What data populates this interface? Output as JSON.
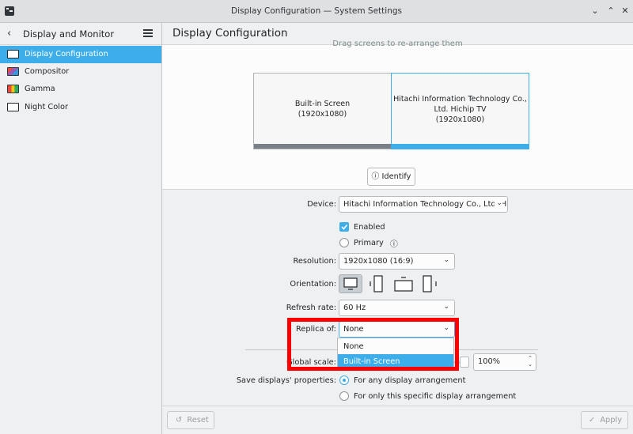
{
  "window": {
    "title": "Display Configuration — System Settings",
    "buttons": {
      "menu": "⌄",
      "minimize": "⌃",
      "close": "✕"
    }
  },
  "sidebar": {
    "back_icon": "‹",
    "title": "Display and Monitor",
    "items": [
      {
        "label": "Display Configuration",
        "icon": "monitor-icon",
        "active": true
      },
      {
        "label": "Compositor",
        "icon": "compositor-icon"
      },
      {
        "label": "Gamma",
        "icon": "gamma-icon"
      },
      {
        "label": "Night Color",
        "icon": "night-color-icon"
      }
    ]
  },
  "main": {
    "title": "Display Configuration",
    "drag_hint": "Drag screens to re-arrange them",
    "screens": [
      {
        "name": "Built-in Screen",
        "resolution": "(1920x1080)"
      },
      {
        "name_line1": "Hitachi Information Technology Co.,",
        "name_line2": "Ltd. Hichip TV",
        "resolution": "(1920x1080)"
      }
    ],
    "identify_label": "Identify",
    "info_icon": "ⓘ"
  },
  "settings": {
    "device_label": "Device:",
    "device_value": "Hitachi Information Technology Co., Ltd. Hichip TV",
    "enabled_label": "Enabled",
    "primary_label": "Primary",
    "resolution_label": "Resolution:",
    "resolution_value": "1920x1080 (16:9)",
    "orientation_label": "Orientation:",
    "refresh_label": "Refresh rate:",
    "refresh_value": "60 Hz",
    "replica_label": "Replica of:",
    "replica_value": "None",
    "replica_options": [
      "None",
      "Built-in Screen"
    ],
    "global_scale_label": "Global scale:",
    "global_scale_value": "100%",
    "save_label": "Save displays' properties:",
    "save_options": [
      "For any display arrangement",
      "For only this specific display arrangement"
    ]
  },
  "footer": {
    "reset_label": "Reset",
    "apply_label": "Apply"
  },
  "colors": {
    "accent": "#3daee9",
    "highlight": "#ff0000",
    "background": "#eff0f1"
  }
}
